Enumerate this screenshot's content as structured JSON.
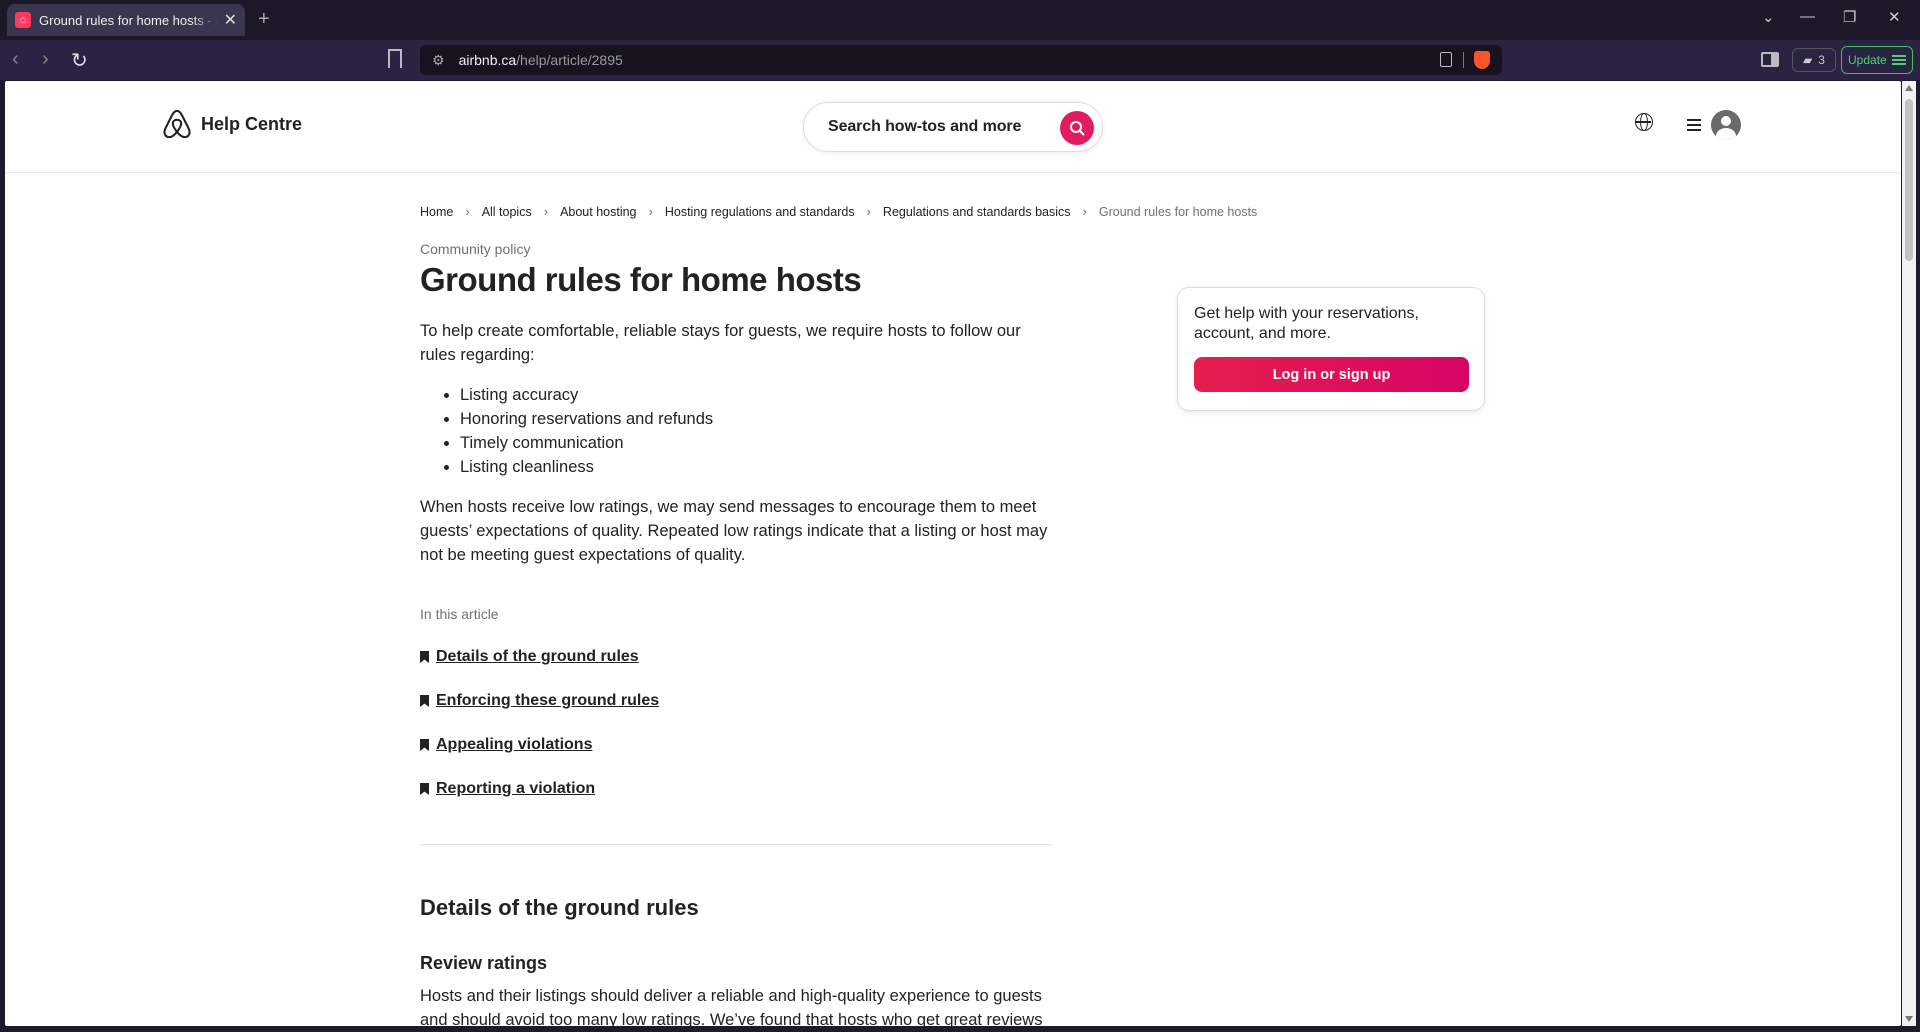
{
  "browser": {
    "tab_title": "Ground rules for home hosts - Airbnb Help Centre",
    "url_host": "airbnb.ca",
    "url_path": "/help/article/2895",
    "wallet_count": "3",
    "update_label": "Update"
  },
  "header": {
    "brand": "Help Centre",
    "search_placeholder": "Search how-tos and more",
    "accent_color": "#e31c5f"
  },
  "breadcrumb": [
    "Home",
    "All topics",
    "About hosting",
    "Hosting regulations and standards",
    "Regulations and standards basics",
    "Ground rules for home hosts"
  ],
  "article": {
    "eyebrow": "Community policy",
    "title": "Ground rules for home hosts",
    "intro": "To help create comfortable, reliable stays for guests, we require hosts to follow our rules regarding:",
    "rules": [
      "Listing accuracy",
      "Honoring reservations and refunds",
      "Timely communication",
      "Listing cleanliness"
    ],
    "paragraph2": "When hosts receive low ratings, we may send messages to encourage them to meet guests’ expectations of quality. Repeated low ratings indicate that a listing or host may not be meeting guest expectations of quality.",
    "toc_heading": "In this article",
    "toc": [
      "Details of the ground rules",
      "Enforcing these ground rules",
      "Appealing violations",
      "Reporting a violation"
    ],
    "section_title": "Details of the ground rules",
    "subsection_title": "Review ratings",
    "section_text": "Hosts and their listings should deliver a reliable and high-quality experience to guests and should avoid too many low ratings. We’ve found that hosts who get great reviews"
  },
  "help_card": {
    "text": "Get help with your reservations, account, and more.",
    "button": "Log in or sign up"
  }
}
